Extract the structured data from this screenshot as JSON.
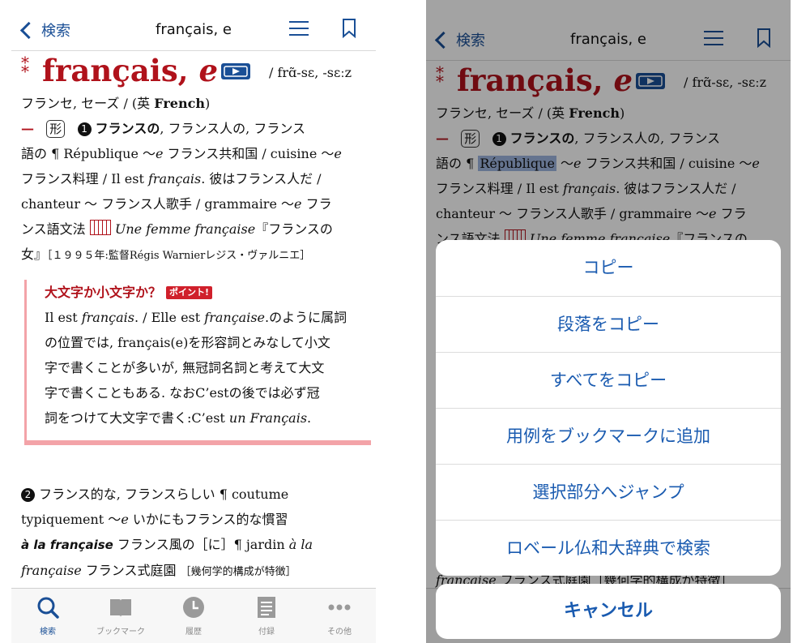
{
  "nav": {
    "back_label": "検索",
    "title": "français, e"
  },
  "entry": {
    "asterisk": "*",
    "headword": "français, ",
    "headword_fem": "e",
    "pronunciation": "/ frɑ̃-sɛ, -sɛːz",
    "reading": "フランセ, セーズ / (英 ",
    "english": "French",
    "english_close": ")",
    "dash": "—",
    "pos": "形",
    "sense1_num": "1",
    "sense1_lines": [
      [
        "フランスの",
        ", フランス人の, フランス"
      ],
      [
        "語の ¶ République ～",
        "e",
        " フランス共和国 / cuisine ～",
        "e"
      ],
      [
        " フランス料理 / Il est ",
        "français",
        ". 彼はフランス人だ /"
      ],
      [
        "chanteur ～ フランス人歌手 / grammaire ～",
        "e",
        " フラ"
      ],
      [
        "ンス語文法 ",
        "Une femme française",
        "『フランスの"
      ],
      [
        "女』",
        "［１９９５年:監督Régis Warnierレジス・ヴァルニエ］"
      ]
    ]
  },
  "note": {
    "title": "大文字か小文字か？",
    "badge": "ポイント!",
    "lines": [
      [
        "Il est ",
        "français",
        ". / Elle est ",
        "française",
        ".のように属詞"
      ],
      [
        "の位置では, français(e)を形容詞とみなして小文"
      ],
      [
        "字で書くことが多いが, 無冠詞名詞と考えて大文"
      ],
      [
        "字で書くこともある. なおC’estの後では必ず冠"
      ],
      [
        "詞をつけて大文字で書く:C’est ",
        "un Français",
        "."
      ]
    ]
  },
  "sense2": {
    "num": "2",
    "lines": [
      [
        " フランス的な, フランスらしい ¶ coutume"
      ],
      [
        "typiquement ～",
        "e",
        " いかにもフランス的な慣習"
      ],
      [
        "à la française",
        " フランス風の［に］¶ jardin ",
        "à la"
      ],
      [
        "française",
        " フランス式庭園 ",
        "［幾何学的構成が特徴］"
      ]
    ]
  },
  "tabs": [
    {
      "label": "検索",
      "icon": "search-icon",
      "active": true
    },
    {
      "label": "ブックマーク",
      "icon": "book-icon",
      "active": false
    },
    {
      "label": "履歴",
      "icon": "clock-icon",
      "active": false
    },
    {
      "label": "付録",
      "icon": "document-icon",
      "active": false
    },
    {
      "label": "その他",
      "icon": "more-icon",
      "active": false
    }
  ],
  "right": {
    "sense2_partial": "française",
    "sense2_partial_rest": " フランス式庭園［幾何学的構成が特徴］",
    "highlighted_word": "République"
  },
  "action_sheet": {
    "items": [
      "コピー",
      "段落をコピー",
      "すべてをコピー",
      "用例をブックマークに追加",
      "選択部分へジャンプ",
      "ロベール仏和大辞典で検索"
    ],
    "cancel": "キャンセル"
  },
  "colors": {
    "accent": "#1a4f96",
    "headword": "#b0121b",
    "note_border": "#f3a3a8"
  }
}
